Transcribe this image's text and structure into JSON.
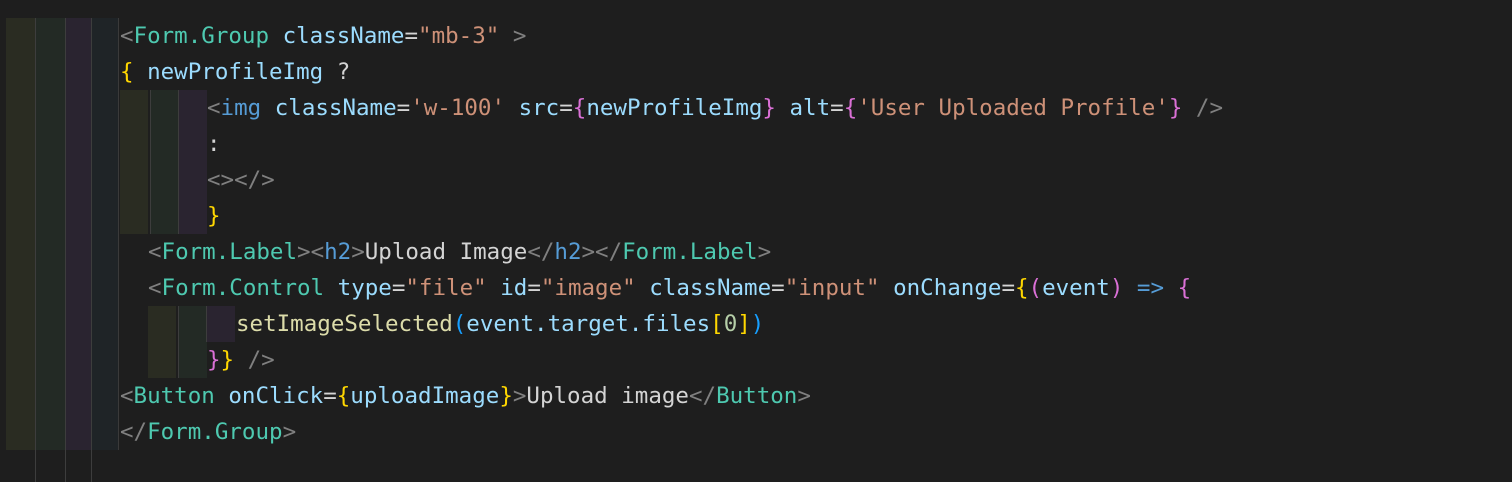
{
  "editor": {
    "lines": [
      {
        "parts": [
          {
            "t": "<",
            "c": "tag-bracket"
          },
          {
            "t": "Form.Group",
            "c": "tag"
          },
          {
            "t": " ",
            "c": "plain"
          },
          {
            "t": "className",
            "c": "attr"
          },
          {
            "t": "=",
            "c": "plain"
          },
          {
            "t": "\"mb-3\"",
            "c": "str"
          },
          {
            "t": " >",
            "c": "tag-bracket"
          }
        ]
      },
      {
        "parts": [
          {
            "t": "{",
            "c": "brace-y"
          },
          {
            "t": " newProfileImg",
            "c": "var"
          },
          {
            "t": " ?",
            "c": "plain"
          }
        ]
      },
      {
        "parts": [
          {
            "t": "<",
            "c": "tag-bracket"
          },
          {
            "t": "img",
            "c": "html-tag"
          },
          {
            "t": " ",
            "c": "plain"
          },
          {
            "t": "className",
            "c": "attr"
          },
          {
            "t": "=",
            "c": "plain"
          },
          {
            "t": "'w-100'",
            "c": "str"
          },
          {
            "t": " ",
            "c": "plain"
          },
          {
            "t": "src",
            "c": "attr"
          },
          {
            "t": "=",
            "c": "plain"
          },
          {
            "t": "{",
            "c": "brace-p"
          },
          {
            "t": "newProfileImg",
            "c": "var"
          },
          {
            "t": "}",
            "c": "brace-p"
          },
          {
            "t": " ",
            "c": "plain"
          },
          {
            "t": "alt",
            "c": "attr"
          },
          {
            "t": "=",
            "c": "plain"
          },
          {
            "t": "{",
            "c": "brace-p"
          },
          {
            "t": "'User Uploaded Profile'",
            "c": "str"
          },
          {
            "t": "}",
            "c": "brace-p"
          },
          {
            "t": " />",
            "c": "tag-bracket"
          }
        ]
      },
      {
        "parts": [
          {
            "t": ":",
            "c": "plain"
          }
        ]
      },
      {
        "parts": [
          {
            "t": "<></>",
            "c": "tag-bracket"
          }
        ]
      },
      {
        "parts": [
          {
            "t": "}",
            "c": "brace-y"
          }
        ]
      },
      {
        "parts": [
          {
            "t": "<",
            "c": "tag-bracket"
          },
          {
            "t": "Form.Label",
            "c": "tag"
          },
          {
            "t": ">",
            "c": "tag-bracket"
          },
          {
            "t": "<",
            "c": "tag-bracket"
          },
          {
            "t": "h2",
            "c": "html-tag"
          },
          {
            "t": ">",
            "c": "tag-bracket"
          },
          {
            "t": "Upload Image",
            "c": "plain"
          },
          {
            "t": "</",
            "c": "tag-bracket"
          },
          {
            "t": "h2",
            "c": "html-tag"
          },
          {
            "t": ">",
            "c": "tag-bracket"
          },
          {
            "t": "</",
            "c": "tag-bracket"
          },
          {
            "t": "Form.Label",
            "c": "tag"
          },
          {
            "t": ">",
            "c": "tag-bracket"
          }
        ]
      },
      {
        "parts": [
          {
            "t": "<",
            "c": "tag-bracket"
          },
          {
            "t": "Form.Control",
            "c": "tag"
          },
          {
            "t": " ",
            "c": "plain"
          },
          {
            "t": "type",
            "c": "attr"
          },
          {
            "t": "=",
            "c": "plain"
          },
          {
            "t": "\"file\"",
            "c": "str"
          },
          {
            "t": " ",
            "c": "plain"
          },
          {
            "t": "id",
            "c": "attr"
          },
          {
            "t": "=",
            "c": "plain"
          },
          {
            "t": "\"image\"",
            "c": "str"
          },
          {
            "t": " ",
            "c": "plain"
          },
          {
            "t": "className",
            "c": "attr"
          },
          {
            "t": "=",
            "c": "plain"
          },
          {
            "t": "\"input\"",
            "c": "str"
          },
          {
            "t": " ",
            "c": "plain"
          },
          {
            "t": "onChange",
            "c": "attr"
          },
          {
            "t": "=",
            "c": "plain"
          },
          {
            "t": "{",
            "c": "brace-y"
          },
          {
            "t": "(",
            "c": "brace-p"
          },
          {
            "t": "event",
            "c": "var"
          },
          {
            "t": ")",
            "c": "brace-p"
          },
          {
            "t": " => ",
            "c": "arrow"
          },
          {
            "t": "{",
            "c": "brace-p"
          }
        ]
      },
      {
        "parts": [
          {
            "t": "setImageSelected",
            "c": "fn"
          },
          {
            "t": "(",
            "c": "brace-b"
          },
          {
            "t": "event.target.files",
            "c": "var"
          },
          {
            "t": "[",
            "c": "brace-y"
          },
          {
            "t": "0",
            "c": "num"
          },
          {
            "t": "]",
            "c": "brace-y"
          },
          {
            "t": ")",
            "c": "brace-b"
          }
        ]
      },
      {
        "parts": [
          {
            "t": "}",
            "c": "brace-p"
          },
          {
            "t": "}",
            "c": "brace-y"
          },
          {
            "t": " />",
            "c": "tag-bracket"
          }
        ]
      },
      {
        "parts": [
          {
            "t": "<",
            "c": "tag-bracket"
          },
          {
            "t": "Button",
            "c": "tag"
          },
          {
            "t": " ",
            "c": "plain"
          },
          {
            "t": "onClick",
            "c": "attr"
          },
          {
            "t": "=",
            "c": "plain"
          },
          {
            "t": "{",
            "c": "brace-y"
          },
          {
            "t": "uploadImage",
            "c": "var"
          },
          {
            "t": "}",
            "c": "brace-y"
          },
          {
            "t": ">",
            "c": "tag-bracket"
          },
          {
            "t": "Upload image",
            "c": "plain"
          },
          {
            "t": "</",
            "c": "tag-bracket"
          },
          {
            "t": "Button",
            "c": "tag"
          },
          {
            "t": ">",
            "c": "tag-bracket"
          }
        ]
      },
      {
        "parts": [
          {
            "t": "</",
            "c": "tag-bracket"
          },
          {
            "t": "Form.Group",
            "c": "tag"
          },
          {
            "t": ">",
            "c": "tag-bracket"
          }
        ]
      }
    ]
  }
}
